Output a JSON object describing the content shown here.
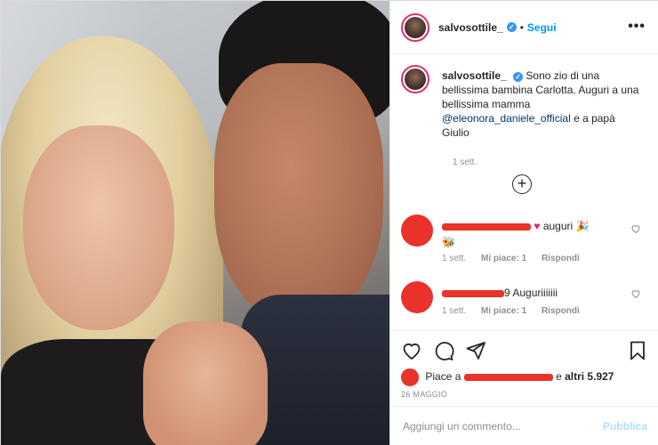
{
  "post": {
    "author": "salvosottile_",
    "follow_label": "Segui",
    "separator": "•",
    "more_label": "•••"
  },
  "caption": {
    "username": "salvosottile_",
    "text_1": "Sono zio di una bellissima bambina Carlotta. Auguri a una bellissima mamma ",
    "mention": "@eleonora_daniele_official",
    "text_2": " e a papà Giulio",
    "time": "1 sett."
  },
  "comments": [
    {
      "text": "auguri",
      "meta_time": "1 sett.",
      "likes_label": "Mi piace: 1",
      "reply_label": "Rispondi"
    },
    {
      "text": "9 Auguriiiiiii",
      "meta_time": "1 sett.",
      "likes_label": "Mi piace: 1",
      "reply_label": "Rispondi"
    }
  ],
  "likes": {
    "prefix": "Piace a",
    "middle": "e",
    "count_label": "altri 5.927"
  },
  "date": "26 MAGGIO",
  "add_comment": {
    "placeholder": "Aggiungi un commento...",
    "publish_label": "Pubblica"
  },
  "colors": {
    "accent": "#0095f6",
    "redaction": "#e8322a",
    "publish_disabled": "#b2dffc"
  }
}
